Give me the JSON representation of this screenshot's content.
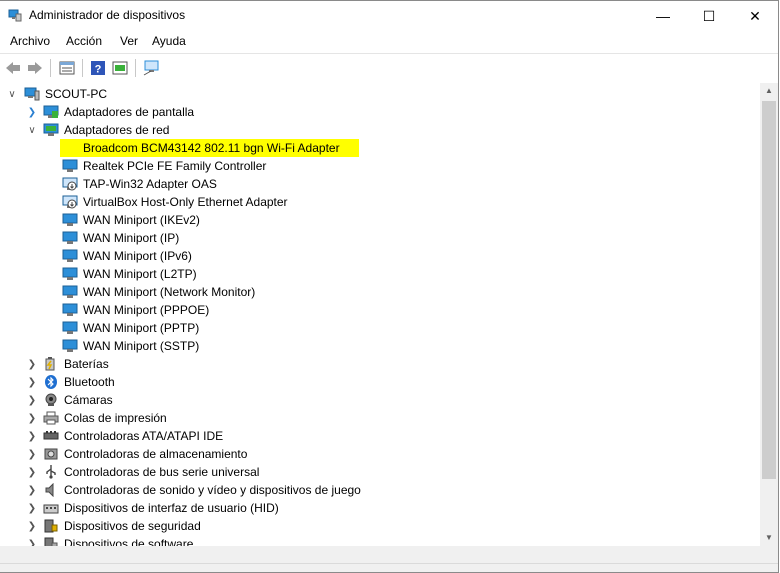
{
  "window": {
    "title": "Administrador de dispositivos",
    "controls": {
      "minimize": "—",
      "maximize": "☐",
      "close": "✕"
    }
  },
  "menu": [
    "Archivo",
    "Acción",
    "Ver",
    "Ayuda"
  ],
  "toolbar": {
    "buttons": [
      "back-icon",
      "forward-icon",
      "properties-icon",
      "help-icon",
      "update-icon",
      "scan-icon"
    ]
  },
  "tree": {
    "root": "SCOUT-PC",
    "categories": [
      {
        "label": "Adaptadores de pantalla",
        "icon": "display-adapter-icon",
        "expanded": false
      },
      {
        "label": "Adaptadores de red",
        "icon": "network-adapter-icon",
        "expanded": true,
        "children": [
          {
            "label": "Broadcom BCM43142 802.11 bgn Wi-Fi Adapter",
            "selected": true
          },
          {
            "label": "Realtek PCIe FE Family Controller"
          },
          {
            "label": "TAP-Win32 Adapter OAS",
            "disabled_badge": true
          },
          {
            "label": "VirtualBox Host-Only Ethernet Adapter",
            "disabled_badge": true
          },
          {
            "label": "WAN Miniport (IKEv2)"
          },
          {
            "label": "WAN Miniport (IP)"
          },
          {
            "label": "WAN Miniport (IPv6)"
          },
          {
            "label": "WAN Miniport (L2TP)"
          },
          {
            "label": "WAN Miniport (Network Monitor)"
          },
          {
            "label": "WAN Miniport (PPPOE)"
          },
          {
            "label": "WAN Miniport (PPTP)"
          },
          {
            "label": "WAN Miniport (SSTP)"
          }
        ]
      },
      {
        "label": "Baterías",
        "icon": "battery-icon"
      },
      {
        "label": "Bluetooth",
        "icon": "bluetooth-icon"
      },
      {
        "label": "Cámaras",
        "icon": "camera-icon"
      },
      {
        "label": "Colas de impresión",
        "icon": "printer-icon"
      },
      {
        "label": "Controladoras ATA/ATAPI IDE",
        "icon": "ide-icon"
      },
      {
        "label": "Controladoras de almacenamiento",
        "icon": "storage-icon"
      },
      {
        "label": "Controladoras de bus serie universal",
        "icon": "usb-icon"
      },
      {
        "label": "Controladoras de sonido y vídeo y dispositivos de juego",
        "icon": "speaker-icon"
      },
      {
        "label": "Dispositivos de interfaz de usuario (HID)",
        "icon": "hid-icon"
      },
      {
        "label": "Dispositivos de seguridad",
        "icon": "security-icon"
      },
      {
        "label": "Dispositivos de software",
        "icon": "software-icon"
      }
    ]
  },
  "colors": {
    "selection": "#ffff00",
    "accent": "#2d8fd8",
    "wifi": "#3ab13a"
  }
}
